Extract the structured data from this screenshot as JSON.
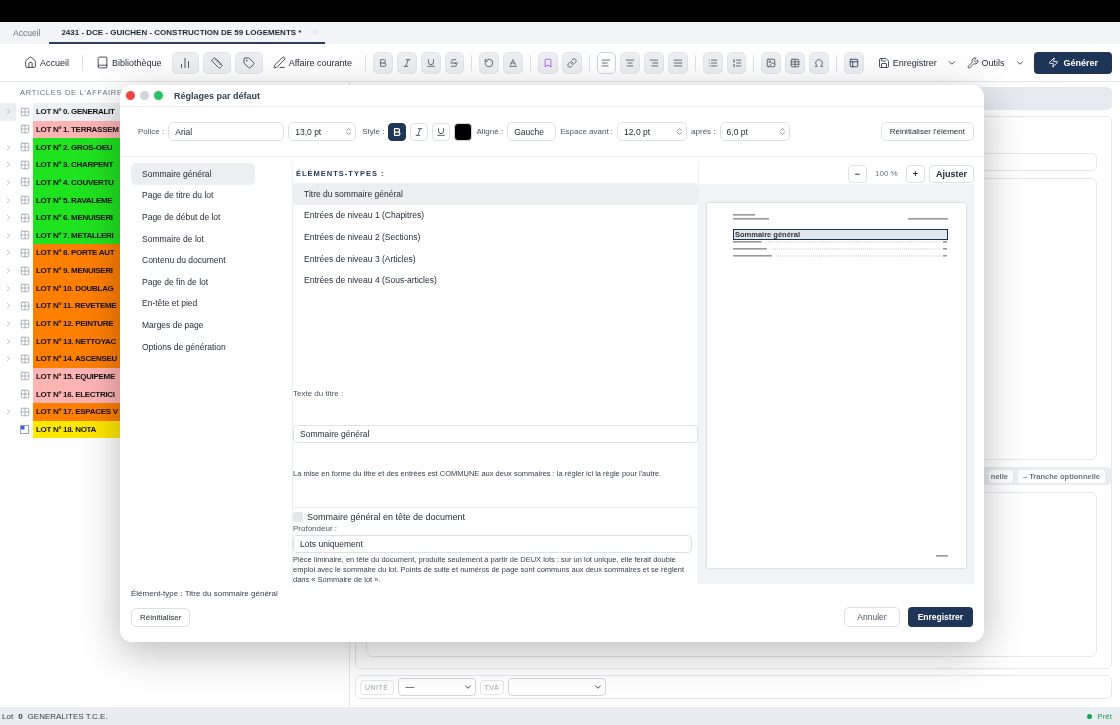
{
  "tabs": [
    {
      "label": "Accueil",
      "selected": false
    },
    {
      "label": "2431 - DCE - GUICHEN - CONSTRUCTION DE 59 LOGEMENTS *",
      "selected": true
    }
  ],
  "toolbar": {
    "home": "Accueil",
    "library": "Bibliothèque",
    "current": "Affaire courante",
    "format_groups": [
      [
        {
          "kind": "bold",
          "selected": false
        },
        {
          "kind": "italic",
          "selected": false
        },
        {
          "kind": "underline",
          "selected": false
        },
        {
          "kind": "strike",
          "selected": false
        }
      ],
      [
        {
          "kind": "undo",
          "selected": false
        },
        {
          "kind": "text-color",
          "selected": false
        }
      ],
      [
        {
          "kind": "bookmark",
          "selected": false
        },
        {
          "kind": "link",
          "selected": false
        }
      ],
      [
        {
          "kind": "align-left",
          "selected": true
        },
        {
          "kind": "align-center",
          "selected": false
        },
        {
          "kind": "align-right",
          "selected": false
        },
        {
          "kind": "justify",
          "selected": false
        }
      ],
      [
        {
          "kind": "bullets",
          "selected": false
        },
        {
          "kind": "numbers",
          "selected": false
        }
      ],
      [
        {
          "kind": "image",
          "selected": false
        },
        {
          "kind": "table",
          "selected": false
        },
        {
          "kind": "symbol",
          "selected": false
        }
      ],
      [
        {
          "kind": "layout",
          "selected": false
        }
      ]
    ],
    "save": "Enregistrer",
    "tools": "Outils",
    "generate": "Générer"
  },
  "articles_header": "ARTICLES DE L'AFFAIRE",
  "lots": [
    {
      "label": "LOT Nº 0. GENERALIT",
      "color": "#eef0f4",
      "expandable": true,
      "kind": "lot",
      "selected": true
    },
    {
      "label": "LOT Nº 1. TERRASSEM",
      "color": "#ffb4b4",
      "expandable": false,
      "kind": "lot",
      "selected": false
    },
    {
      "label": "LOT Nº 2. GROS-OEU",
      "color": "#1fe31f",
      "expandable": true,
      "kind": "lot",
      "selected": false
    },
    {
      "label": "LOT Nº 3. CHARPENT",
      "color": "#1fe31f",
      "expandable": true,
      "kind": "lot",
      "selected": false
    },
    {
      "label": "LOT Nº 4. COUVERTU",
      "color": "#1fe31f",
      "expandable": true,
      "kind": "lot",
      "selected": false
    },
    {
      "label": "LOT Nº 5. RAVALEME",
      "color": "#1fe31f",
      "expandable": true,
      "kind": "lot",
      "selected": false
    },
    {
      "label": "LOT Nº 6. MENUISERI",
      "color": "#1fe31f",
      "expandable": true,
      "kind": "lot",
      "selected": false
    },
    {
      "label": "LOT Nº 7. METALLERI",
      "color": "#1fe31f",
      "expandable": true,
      "kind": "lot",
      "selected": false
    },
    {
      "label": "LOT Nº 8. PORTE AUT",
      "color": "#ff7f00",
      "expandable": true,
      "kind": "lot",
      "selected": false
    },
    {
      "label": "LOT Nº 9. MENUISERI",
      "color": "#ff7f00",
      "expandable": true,
      "kind": "lot",
      "selected": false
    },
    {
      "label": "LOT Nº 10. DOUBLAG",
      "color": "#ff7f00",
      "expandable": true,
      "kind": "lot",
      "selected": false
    },
    {
      "label": "LOT Nº 11. REVETEME",
      "color": "#ff7f00",
      "expandable": true,
      "kind": "lot",
      "selected": false
    },
    {
      "label": "LOT Nº 12. PEINTURE",
      "color": "#ff7f00",
      "expandable": true,
      "kind": "lot",
      "selected": false
    },
    {
      "label": "LOT Nº 13. NETTOYAC",
      "color": "#ff7f00",
      "expandable": true,
      "kind": "lot",
      "selected": false
    },
    {
      "label": "LOT Nº 14. ASCENSEU",
      "color": "#ff7f00",
      "expandable": true,
      "kind": "lot",
      "selected": false
    },
    {
      "label": "LOT Nº 15. EQUIPEME",
      "color": "#ffb4b4",
      "expandable": false,
      "kind": "lot",
      "selected": false
    },
    {
      "label": "LOT Nº 16. ELECTRICI",
      "color": "#ffb4b4",
      "expandable": false,
      "kind": "lot",
      "selected": false
    },
    {
      "label": "LOT Nº 17. ESPACES V",
      "color": "#ff7f00",
      "expandable": true,
      "kind": "lot",
      "selected": false
    },
    {
      "label": "LOT Nº 18. NOTA",
      "color": "#ffe800",
      "expandable": false,
      "kind": "note",
      "selected": false
    }
  ],
  "detail": {
    "chips": [
      "nelle",
      "– Tranche optionnelle"
    ],
    "unit_label": "UNITÉ",
    "unit_value": "—",
    "vat_label": "TVA"
  },
  "dialog": {
    "title": "Réglages par défaut",
    "format": {
      "font_label": "Police :",
      "font": "Arial",
      "size": "13,0 pt",
      "style_label": "Style :",
      "styles": [
        {
          "kind": "bold",
          "selected": true
        },
        {
          "kind": "italic",
          "selected": false
        },
        {
          "kind": "underline",
          "selected": false
        }
      ],
      "color": "#000000",
      "align_label": "Aligné :",
      "align": "Gauche",
      "space_before_label": "Espace avant :",
      "space_before": "12,0 pt",
      "space_after_label": "après :",
      "space_after": "6,0 pt",
      "reset_element": "Réinitialiser l'élément"
    },
    "nav": [
      {
        "label": "Sommaire général",
        "selected": true
      },
      {
        "label": "Page de titre du lot",
        "selected": false
      },
      {
        "label": "Page de début de lot",
        "selected": false
      },
      {
        "label": "Sommaire de lot",
        "selected": false
      },
      {
        "label": "Contenu du document",
        "selected": false
      },
      {
        "label": "Page de fin de lot",
        "selected": false
      },
      {
        "label": "En-tête et pied",
        "selected": false
      },
      {
        "label": "Marges de page",
        "selected": false
      },
      {
        "label": "Options de génération",
        "selected": false
      }
    ],
    "elements_header": "ÉLÉMENTS-TYPES :",
    "elements": [
      {
        "label": "Titre du sommaire général",
        "selected": true
      },
      {
        "label": "Entrées de niveau 1 (Chapitres)",
        "selected": false
      },
      {
        "label": "Entrées de niveau 2 (Sections)",
        "selected": false
      },
      {
        "label": "Entrées de niveau 3 (Articles)",
        "selected": false
      },
      {
        "label": "Entrées de niveau 4 (Sous-articles)",
        "selected": false
      }
    ],
    "title_text_label": "Texte du titre :",
    "title_text": "Sommaire général",
    "note": "La mise en forme du titre et des entrées est COMMUNE aux deux sommaires : la régler ici la règle pour l'autre.",
    "toc_checkbox": {
      "label": "Sommaire général en tête de document",
      "checked": false
    },
    "depth_label": "Profondeur :",
    "depth": "Lots uniquement",
    "depth_note": "Pièce liminaire, en tête du document, produite seulement à partir de DEUX lots : sur un lot unique, elle ferait double emploi avec le sommaire du lot. Points de suite et numéros de page sont communs aux deux sommaires et se règlent dans « Sommaire de lot ».",
    "zoom": {
      "minus": "−",
      "level": "100 %",
      "plus": "+",
      "fit": "Ajuster"
    },
    "preview": {
      "heading": "Sommaire général"
    },
    "element_type": "Élément-type : Titre du sommaire général",
    "reset": "Réinitialiser",
    "cancel": "Annuler",
    "save": "Enregistrer"
  },
  "status": {
    "lot_label": "Lot",
    "lot_number": "0",
    "lot_name": "GENERALITES T.C.E.",
    "state": "Prêt"
  }
}
